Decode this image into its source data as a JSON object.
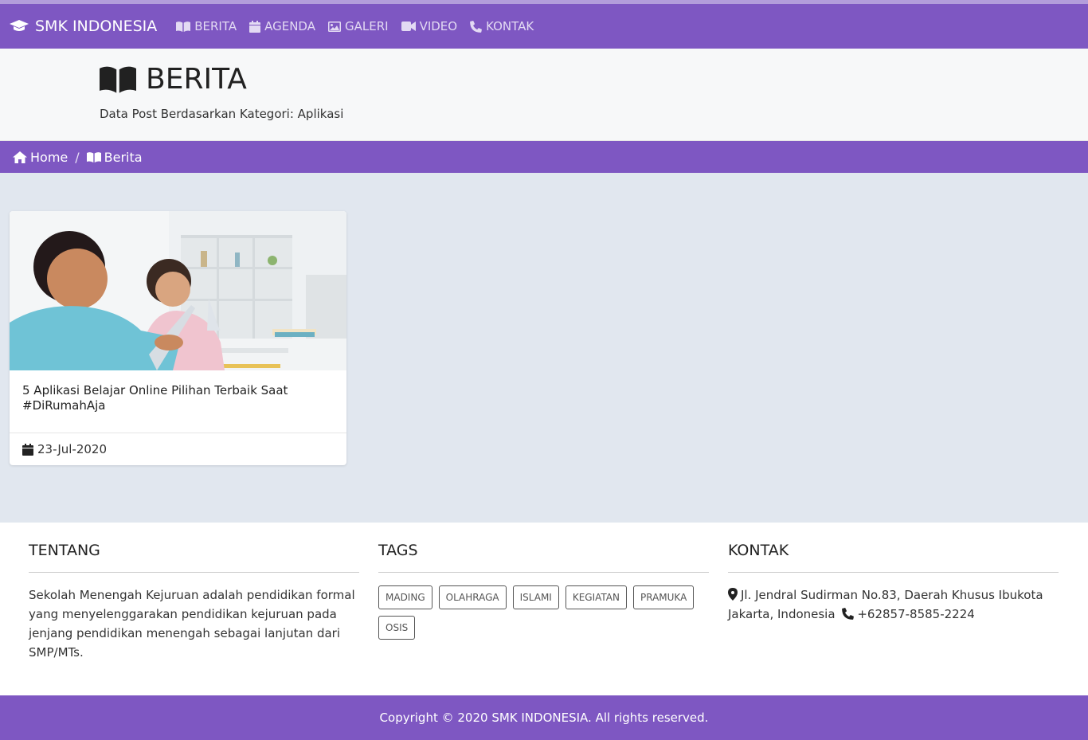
{
  "navbar": {
    "brand": "SMK INDONESIA",
    "items": [
      {
        "label": "BERITA",
        "icon": "book-open-icon"
      },
      {
        "label": "AGENDA",
        "icon": "calendar-icon"
      },
      {
        "label": "GALERI",
        "icon": "image-icon"
      },
      {
        "label": "VIDEO",
        "icon": "video-camera-icon"
      },
      {
        "label": "KONTAK",
        "icon": "phone-icon"
      }
    ]
  },
  "header": {
    "title": "BERITA",
    "subtitle": "Data Post Berdasarkan Kategori: Aplikasi"
  },
  "breadcrumb": {
    "home": "Home",
    "separator": "/",
    "current": "Berita"
  },
  "posts": [
    {
      "title": "5 Aplikasi Belajar Online Pilihan Terbaik Saat #DiRumahAja",
      "date": "23-Jul-2020"
    }
  ],
  "footer": {
    "about": {
      "heading": "TENTANG",
      "text": "Sekolah Menengah Kejuruan adalah pendidikan formal yang menyelenggarakan pendidikan kejuruan pada jenjang pendidikan menengah sebagai lanjutan dari SMP/MTs."
    },
    "tags": {
      "heading": "TAGS",
      "items": [
        "MADING",
        "OLAHRAGA",
        "ISLAMI",
        "KEGIATAN",
        "PRAMUKA",
        "OSIS"
      ]
    },
    "contact": {
      "heading": "KONTAK",
      "address": "Jl. Jendral Sudirman No.83, Daerah Khusus Ibukota Jakarta, Indonesia",
      "phone": "+62857-8585-2224"
    }
  },
  "copyright": "Copyright © 2020 SMK INDONESIA. All rights reserved.",
  "colors": {
    "primary": "#7e57c2",
    "content_bg": "#e1e7ef"
  }
}
